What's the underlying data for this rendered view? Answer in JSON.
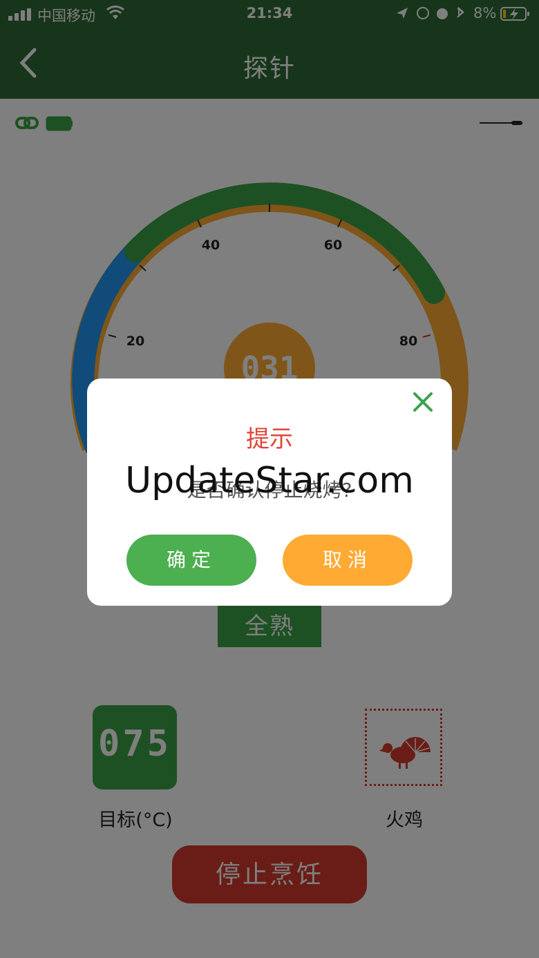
{
  "status_bar": {
    "carrier": "中国移动",
    "time": "21:34",
    "battery_pct": "8%"
  },
  "nav": {
    "title": "探针"
  },
  "gauge": {
    "ticks": [
      "20",
      "40",
      "60",
      "80"
    ],
    "current_value": "031",
    "colors": {
      "green": "#3aa347",
      "blue": "#2196f3",
      "orange": "#ffaa33"
    }
  },
  "doneness": "全熟",
  "target": {
    "value": "075",
    "label": "目标(°C)"
  },
  "food": {
    "label": "火鸡",
    "icon": "turkey-icon"
  },
  "stop_button": "停止烹饪",
  "dialog": {
    "title": "提示",
    "message": "是否确认停止烧烤?",
    "watermark": "UpdateStar.com",
    "confirm": "确定",
    "cancel": "取消"
  }
}
